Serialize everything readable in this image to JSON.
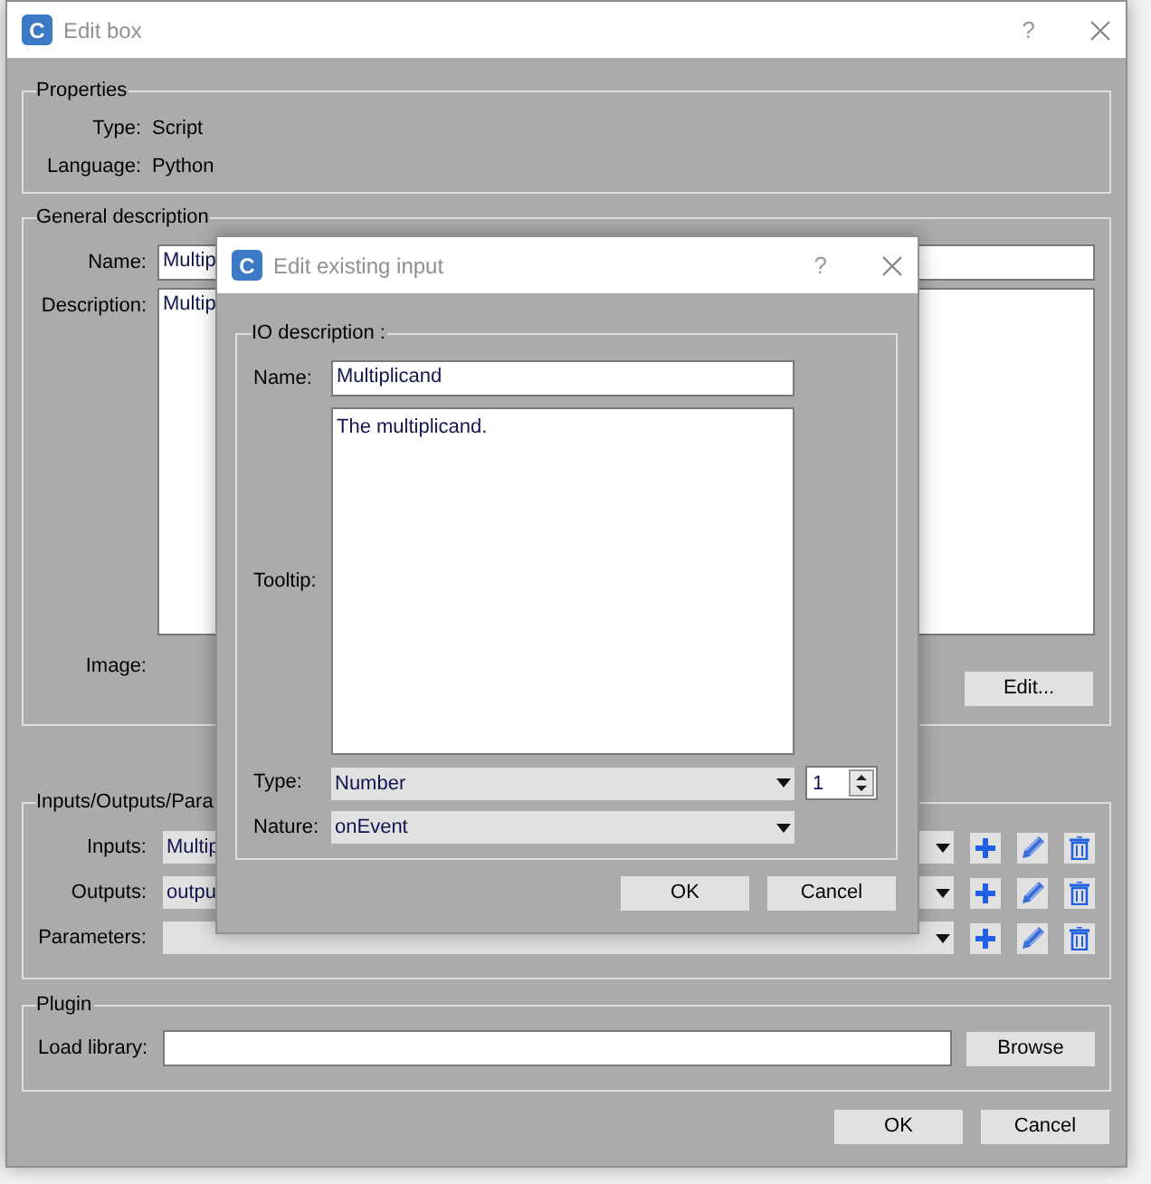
{
  "dialog": {
    "icon_letter": "C",
    "title": "Edit box",
    "help": "?",
    "properties": {
      "title": "Properties",
      "rows": [
        {
          "label": "Type:",
          "value": "Script"
        },
        {
          "label": "Language:",
          "value": "Python"
        }
      ]
    },
    "general": {
      "title": "General description",
      "name_label": "Name:",
      "name_value": "Multip",
      "description_label": "Description:",
      "description_value": "Multip",
      "image_label": "Image:",
      "edit_button": "Edit..."
    },
    "io": {
      "title": "Inputs/Outputs/Para",
      "rows": [
        {
          "label": "Inputs:",
          "value": "Multip"
        },
        {
          "label": "Outputs:",
          "value": "outpu"
        },
        {
          "label": "Parameters:"
        }
      ]
    },
    "plugin": {
      "title": "Plugin",
      "label": "Load library:",
      "button": "Browse"
    },
    "buttons": [
      "OK",
      "Cancel"
    ]
  },
  "input_dialog": {
    "icon_letter": "C",
    "title": "Edit existing input",
    "help": "?",
    "group": "IO description :",
    "name_label": "Name:",
    "name_value": "Multiplicand",
    "tooltip_label": "Tooltip:",
    "tooltip_value": "The multiplicand.",
    "type_label": "Type:",
    "type_value": "Number",
    "count": "1",
    "nature_label": "Nature:",
    "nature_value": "onEvent",
    "buttons": [
      "OK",
      "Cancel"
    ]
  }
}
